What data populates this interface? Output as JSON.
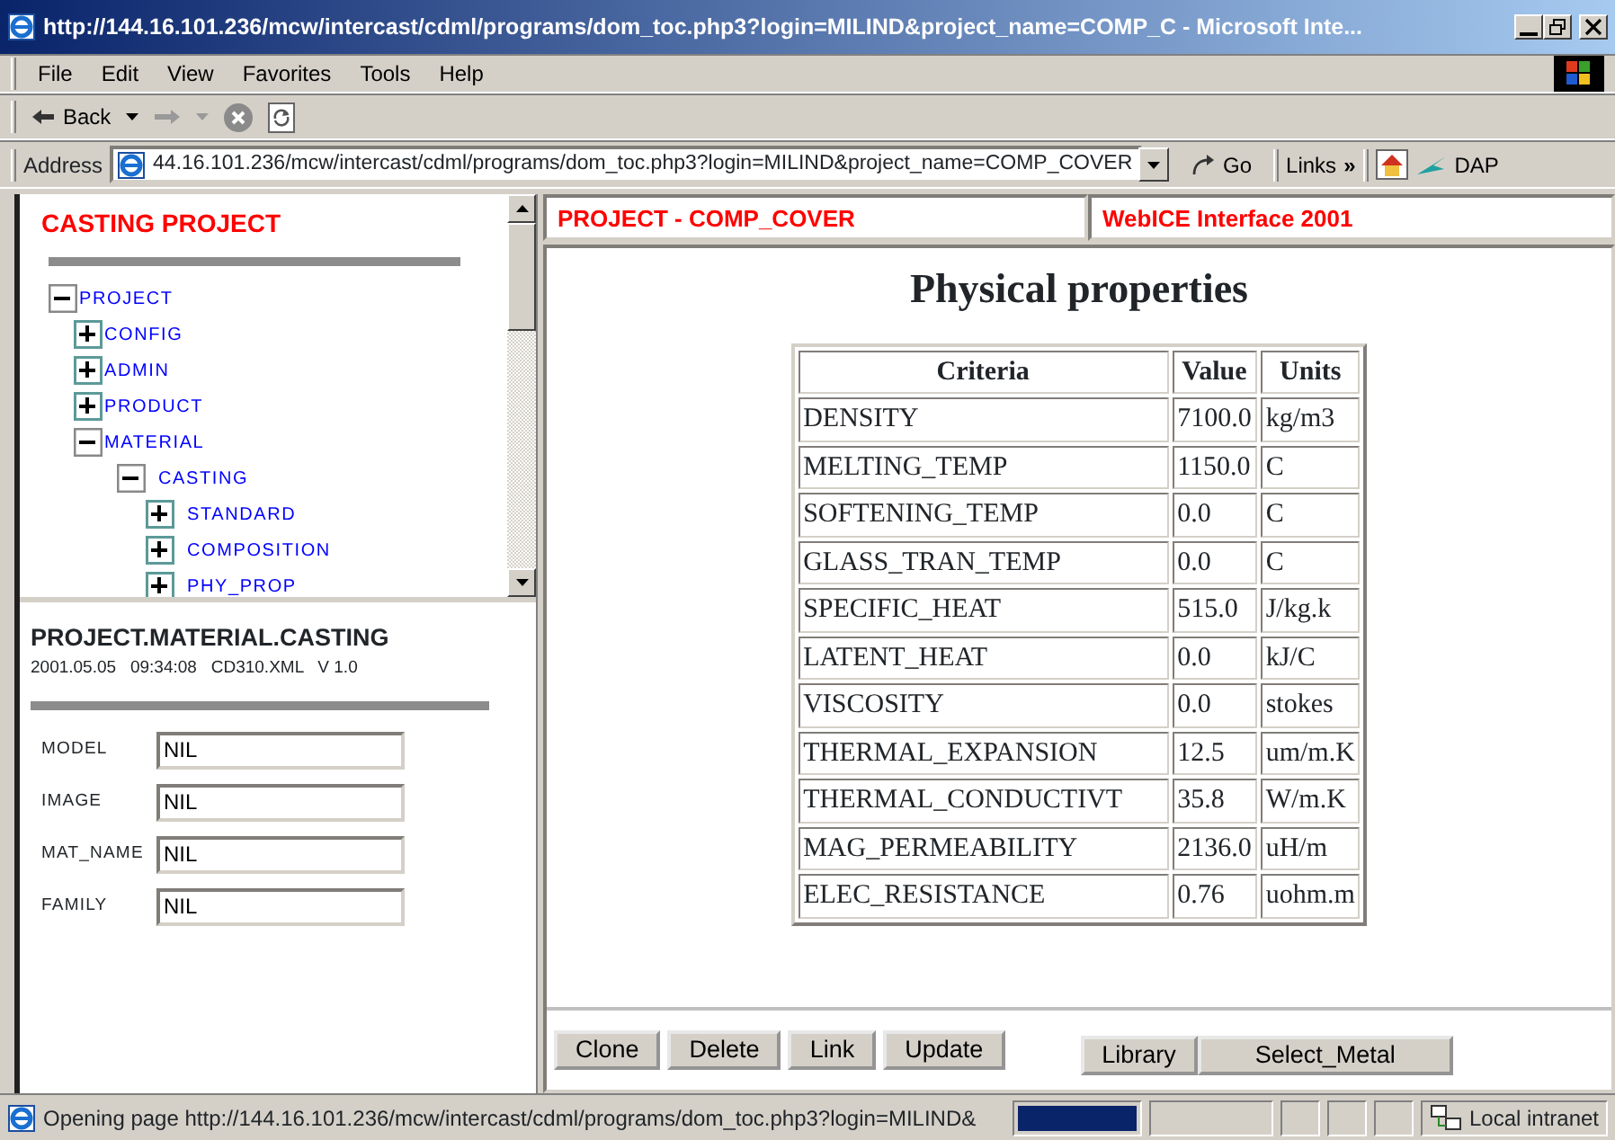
{
  "window": {
    "title": "http://144.16.101.236/mcw/intercast/cdml/programs/dom_toc.php3?login=MILIND&project_name=COMP_C - Microsoft Inte..."
  },
  "menu": [
    "File",
    "Edit",
    "View",
    "Favorites",
    "Tools",
    "Help"
  ],
  "toolbar": {
    "back": "Back"
  },
  "address_bar": {
    "label": "Address",
    "url": "44.16.101.236/mcw/intercast/cdml/programs/dom_toc.php3?login=MILIND&project_name=COMP_COVER",
    "go": "Go",
    "links": "Links",
    "links_more": "»",
    "dap": "DAP"
  },
  "tree_frame": {
    "title": "CASTING PROJECT",
    "tree": [
      {
        "label": "PROJECT",
        "expanded": true,
        "children": [
          {
            "label": "CONFIG",
            "expanded": false
          },
          {
            "label": "ADMIN",
            "expanded": false
          },
          {
            "label": "PRODUCT",
            "expanded": false
          },
          {
            "label": "MATERIAL",
            "expanded": true,
            "children": [
              {
                "label": "CASTING",
                "expanded": true,
                "children": [
                  {
                    "label": "STANDARD",
                    "expanded": false
                  },
                  {
                    "label": "COMPOSITION",
                    "expanded": false
                  },
                  {
                    "label": "PHY_PROP",
                    "expanded": false
                  }
                ]
              }
            ]
          }
        ]
      }
    ]
  },
  "detail": {
    "path": "PROJECT.MATERIAL.CASTING",
    "meta": "2001.05.05   09:34:08   CD310.XML   V 1.0",
    "fields": [
      {
        "label": "MODEL",
        "value": "NIL"
      },
      {
        "label": "IMAGE",
        "value": "NIL"
      },
      {
        "label": "MAT_NAME",
        "value": "NIL"
      },
      {
        "label": "FAMILY",
        "value": "NIL"
      }
    ]
  },
  "header": {
    "project": "PROJECT - COMP_COVER",
    "brand": "WebICE Interface 2001"
  },
  "properties": {
    "title": "Physical properties",
    "columns": [
      "Criteria",
      "Value",
      "Units"
    ],
    "rows": [
      [
        "DENSITY",
        "7100.0",
        "kg/m3"
      ],
      [
        "MELTING_TEMP",
        "1150.0",
        "C"
      ],
      [
        "SOFTENING_TEMP",
        "0.0",
        "C"
      ],
      [
        "GLASS_TRAN_TEMP",
        "0.0",
        "C"
      ],
      [
        "SPECIFIC_HEAT",
        "515.0",
        "J/kg.k"
      ],
      [
        "LATENT_HEAT",
        "0.0",
        "kJ/C"
      ],
      [
        "VISCOSITY",
        "0.0",
        "stokes"
      ],
      [
        "THERMAL_EXPANSION",
        "12.5",
        "um/m.K"
      ],
      [
        "THERMAL_CONDUCTIVT",
        "35.8",
        "W/m.K"
      ],
      [
        "MAG_PERMEABILITY",
        "2136.0",
        "uH/m"
      ],
      [
        "ELEC_RESISTANCE",
        "0.76",
        "uohm.m"
      ]
    ]
  },
  "actions": [
    "Clone",
    "Delete",
    "Link",
    "Update"
  ],
  "lookup_buttons": [
    "Library",
    "Select_Metal"
  ],
  "status_bar": {
    "text": "Opening page http://144.16.101.236/mcw/intercast/cdml/programs/dom_toc.php3?login=MILIND&",
    "level": 1,
    "zone": "Local intranet"
  }
}
